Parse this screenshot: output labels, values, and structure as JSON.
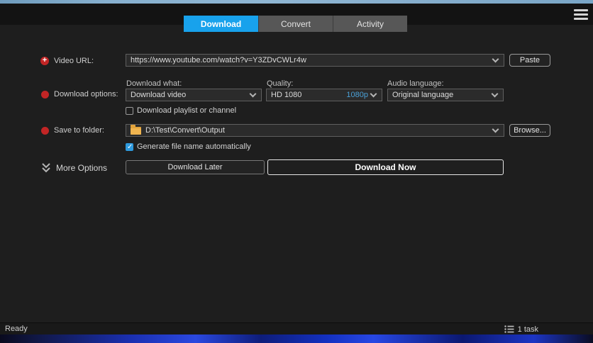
{
  "window": {
    "tabs": [
      {
        "label": "Download",
        "active": true
      },
      {
        "label": "Convert",
        "active": false
      },
      {
        "label": "Activity",
        "active": false
      }
    ]
  },
  "form": {
    "video_url": {
      "label": "Video URL:",
      "value": "https://www.youtube.com/watch?v=Y3ZDvCWLr4w",
      "paste_label": "Paste"
    },
    "download_options": {
      "label": "Download options:",
      "download_what": {
        "label": "Download what:",
        "value": "Download video"
      },
      "quality": {
        "label": "Quality:",
        "value": "HD 1080",
        "badge": "1080p"
      },
      "audio_language": {
        "label": "Audio language:",
        "value": "Original language"
      },
      "playlist_checkbox": {
        "label": "Download playlist or channel",
        "checked": false
      }
    },
    "save_to_folder": {
      "label": "Save to folder:",
      "value": "D:\\Test\\Convert\\Output",
      "browse_label": "Browse...",
      "auto_name_checkbox": {
        "label": "Generate file name automatically",
        "checked": true
      }
    },
    "more_options_label": "More Options",
    "actions": {
      "download_later": "Download Later",
      "download_now": "Download Now"
    }
  },
  "status_bar": {
    "ready": "Ready",
    "tasks": "1 task"
  },
  "colors": {
    "accent": "#18a2ec",
    "quality_badge": "#4aa0d6",
    "red_marker": "#c22525",
    "folder": "#e2a33b"
  }
}
